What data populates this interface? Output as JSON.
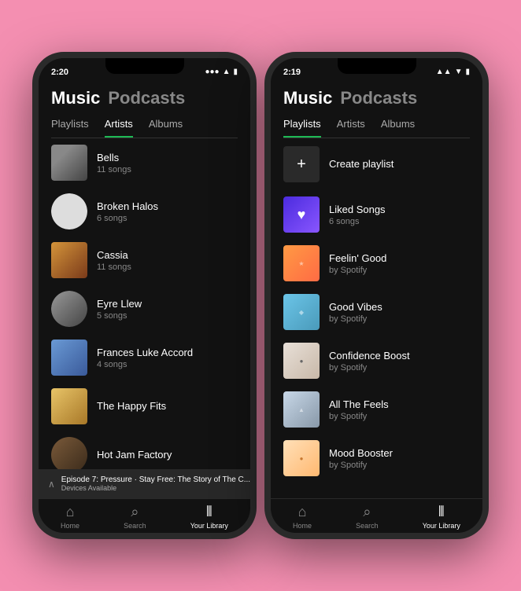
{
  "background": "#f48fb1",
  "phone1": {
    "status": {
      "time": "2:20",
      "signal": "●●●",
      "wifi": "▲",
      "battery": "▮▮▮"
    },
    "header": {
      "title_music": "Music",
      "title_podcasts": "Podcasts"
    },
    "tabs": [
      {
        "label": "Playlists",
        "active": false
      },
      {
        "label": "Artists",
        "active": true
      },
      {
        "label": "Albums",
        "active": false
      }
    ],
    "items": [
      {
        "name": "Bells",
        "sub": "11 songs",
        "art": "bells"
      },
      {
        "name": "Broken Halos",
        "sub": "6 songs",
        "art": "broken"
      },
      {
        "name": "Cassia",
        "sub": "11 songs",
        "art": "cassia"
      },
      {
        "name": "Eyre Llew",
        "sub": "5 songs",
        "art": "eyre"
      },
      {
        "name": "Frances Luke Accord",
        "sub": "4 songs",
        "art": "frances"
      },
      {
        "name": "The Happy Fits",
        "sub": "",
        "art": "happyfits"
      },
      {
        "name": "Hot Jam Factory",
        "sub": "",
        "art": "hotjam"
      }
    ],
    "now_playing": {
      "up_arrow": "∧",
      "title": "Episode 7: Pressure · Stay Free: The Story of The C...",
      "sub": "Devices Available"
    },
    "bottom_nav": [
      {
        "icon": "⌂",
        "label": "Home",
        "active": false
      },
      {
        "icon": "🔍",
        "label": "Search",
        "active": false
      },
      {
        "icon": "|||",
        "label": "Your Library",
        "active": true
      }
    ]
  },
  "phone2": {
    "status": {
      "time": "2:19",
      "signal": "▲▲▲",
      "wifi": "wifi",
      "battery": "▮▮▮▮"
    },
    "header": {
      "title_music": "Music",
      "title_podcasts": "Podcasts"
    },
    "tabs": [
      {
        "label": "Playlists",
        "active": true
      },
      {
        "label": "Artists",
        "active": false
      },
      {
        "label": "Albums",
        "active": false
      }
    ],
    "create_playlist": "Create playlist",
    "items": [
      {
        "name": "Liked Songs",
        "sub": "6 songs",
        "art": "liked"
      },
      {
        "name": "Feelin' Good",
        "sub": "by Spotify",
        "art": "feelin"
      },
      {
        "name": "Good Vibes",
        "sub": "by Spotify",
        "art": "goodvibes"
      },
      {
        "name": "Confidence Boost",
        "sub": "by Spotify",
        "art": "confidence"
      },
      {
        "name": "All The Feels",
        "sub": "by Spotify",
        "art": "allfeels"
      },
      {
        "name": "Mood Booster",
        "sub": "by Spotify",
        "art": "mood"
      }
    ],
    "bottom_nav": [
      {
        "icon": "⌂",
        "label": "Home",
        "active": false
      },
      {
        "icon": "🔍",
        "label": "Search",
        "active": false
      },
      {
        "icon": "|||",
        "label": "Your Library",
        "active": true
      }
    ]
  }
}
